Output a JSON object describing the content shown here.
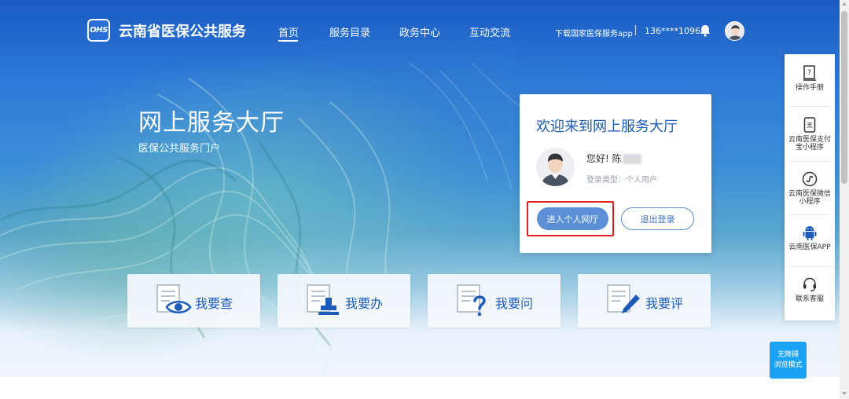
{
  "header": {
    "logo_mark": "OHS",
    "site_title": "云南省医保公共服务",
    "nav": [
      {
        "label": "首页",
        "active": true
      },
      {
        "label": "服务目录",
        "active": false
      },
      {
        "label": "政务中心",
        "active": false
      },
      {
        "label": "互动交流",
        "active": false
      }
    ],
    "download_app": "下载国家医保服务app",
    "separator": "|",
    "phone": "136****1096"
  },
  "hero": {
    "title": "网上服务大厅",
    "subtitle": "医保公共服务门户"
  },
  "welcome_card": {
    "title": "欢迎来到网上服务大厅",
    "greeting": "您好!  陈",
    "login_type": "登录类型：个人用户",
    "enter_button": "进入个人网厅",
    "logout_button": "退出登录"
  },
  "services": [
    {
      "label": "我要查",
      "icon": "document-eye-icon"
    },
    {
      "label": "我要办",
      "icon": "document-stamp-icon"
    },
    {
      "label": "我要问",
      "icon": "document-question-icon"
    },
    {
      "label": "我要评",
      "icon": "document-pen-icon"
    }
  ],
  "side_toolbar": [
    {
      "label": "操作手册",
      "icon": "manual-icon"
    },
    {
      "label": "云南医保支付宝小程序",
      "icon": "alipay-icon"
    },
    {
      "label": "云南医保微信小程序",
      "icon": "mini-program-icon"
    },
    {
      "label": "云南医保APP",
      "icon": "android-icon"
    },
    {
      "label": "联系客服",
      "icon": "headset-icon"
    }
  ],
  "accessibility": {
    "line1": "无障碍",
    "line2": "浏览模式"
  },
  "colors": {
    "brand_blue": "#1d5bb8",
    "button_blue": "#5b8fd6",
    "highlight_red": "#e02020",
    "access_blue": "#1aa3f5"
  }
}
